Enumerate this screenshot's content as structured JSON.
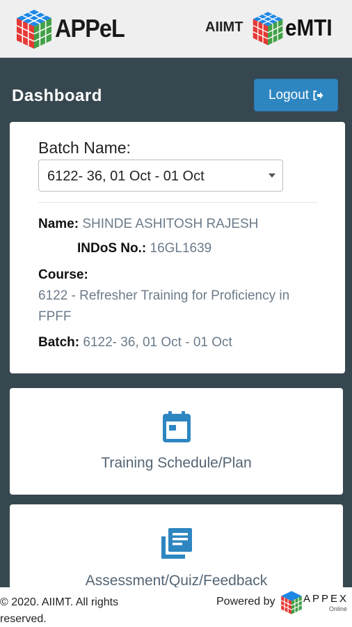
{
  "header": {
    "logo_left_text": "APPeL",
    "right_label": "AIIMT",
    "logo_right_text": "eMTI",
    "logo_icon": "rubiks-cube-icon"
  },
  "dashboard": {
    "title": "Dashboard",
    "logout_label": "Logout",
    "logout_icon": "sign-out-icon"
  },
  "info": {
    "batch_name_label": "Batch Name:",
    "batch_selected": "6122- 36, 01 Oct - 01 Oct",
    "name_label": "Name:",
    "name_value": "SHINDE ASHITOSH RAJESH",
    "indos_label": "INDoS No.:",
    "indos_value": "16GL1639",
    "course_label": "Course:",
    "course_value": "6122 - Refresher Training for Proficiency in FPFF",
    "batch_label": "Batch:",
    "batch_value": "6122- 36, 01 Oct - 01 Oct"
  },
  "menu": [
    {
      "label": "Training Schedule/Plan",
      "icon": "calendar-icon"
    },
    {
      "label": "Assessment/Quiz/Feedback",
      "icon": "document-stack-icon"
    }
  ],
  "footer": {
    "copyright": "© 2020. AIIMT. All rights reserved.",
    "powered_by": "Powered by",
    "brand": "APPEX",
    "brand_sub": "Online"
  },
  "colors": {
    "background": "#37474f",
    "accent": "#2e86c1",
    "cube_red": "#e53935",
    "cube_green": "#43a047",
    "cube_blue": "#1e88e5"
  }
}
